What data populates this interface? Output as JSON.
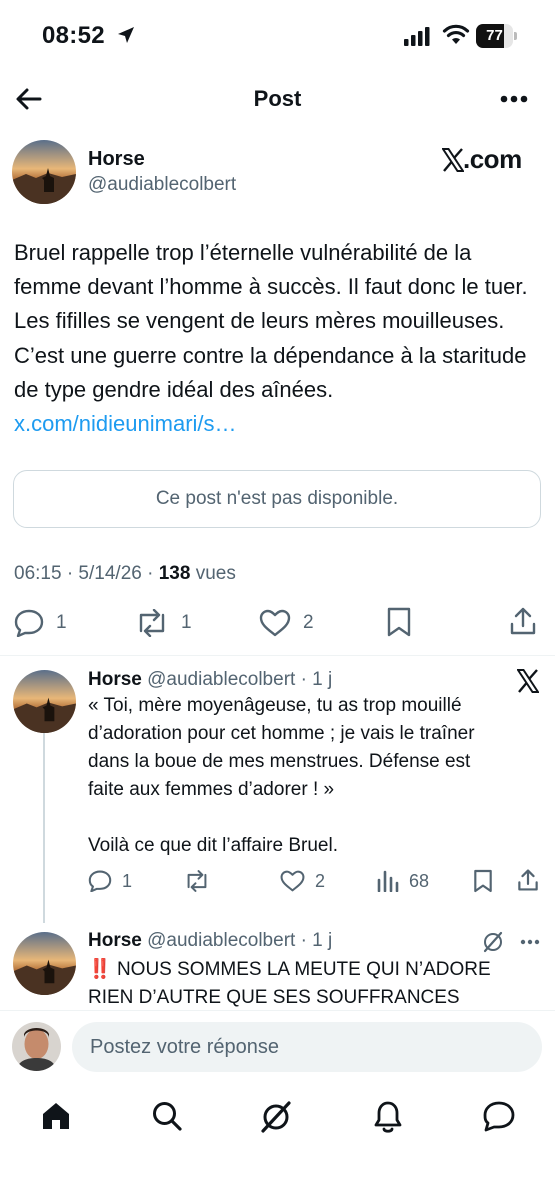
{
  "status_bar": {
    "time": "08:52",
    "battery": "77",
    "battery_level": 0.77
  },
  "header": {
    "title": "Post"
  },
  "main_post": {
    "author_name": "Horse",
    "author_handle": "@audiablecolbert",
    "brand_label": ".com",
    "text": "Bruel rappelle trop l’éternelle vulnérabilité de la femme devant l’homme à succès. Il faut donc le tuer. Les fifilles se vengent de leurs mères mouilleuses. C’est une guerre contre la dépendance à la staritude de type gendre idéal des aînées. ",
    "link": "x.com/nidieunimari/s…",
    "unavailable": "Ce post n'est pas disponible.",
    "timestamp": "06:15 · 5/14/26 · ",
    "views_count": "138",
    "views_label": " vues",
    "replies": "1",
    "reposts": "1",
    "likes": "2"
  },
  "replies": [
    {
      "author_name": "Horse",
      "meta": "@audiablecolbert · 1 j",
      "text_lines": [
        "« Toi, mère moyenâgeuse, tu as trop mouillé",
        "d’adoration pour cet homme ; je vais le traîner",
        "dans la boue de mes menstrues. Défense est",
        "faite aux femmes d’adorer ! »",
        "",
        "Voilà ce que dit l’affaire Bruel."
      ],
      "replies": "1",
      "likes": "2",
      "views": "68"
    },
    {
      "author_name": "Horse",
      "meta": "@audiablecolbert · 1 j",
      "text_lines": [
        "NOUS SOMMES LA MEUTE QUI N’ADORE",
        "RIEN D’AUTRE QUE SES SOUFFRANCES"
      ],
      "emoji": "‼️"
    }
  ],
  "reply_bar": {
    "placeholder": "Postez votre réponse"
  },
  "icons": {
    "back": "arrow-left-icon",
    "more": "more-horizontal-icon",
    "x_logo": "x-logo-icon",
    "reply": "reply-bubble-icon",
    "repost": "repost-icon",
    "like": "heart-icon",
    "bookmark": "bookmark-icon",
    "share": "share-icon",
    "views": "views-bar-icon",
    "grok": "grok-icon",
    "home": "home-icon",
    "search": "search-icon",
    "notifications": "bell-icon",
    "messages": "message-icon"
  },
  "colors": {
    "link": "#1d9bf0",
    "secondary_text": "#536471",
    "text": "#0f1419",
    "border": "#cfd9de"
  }
}
